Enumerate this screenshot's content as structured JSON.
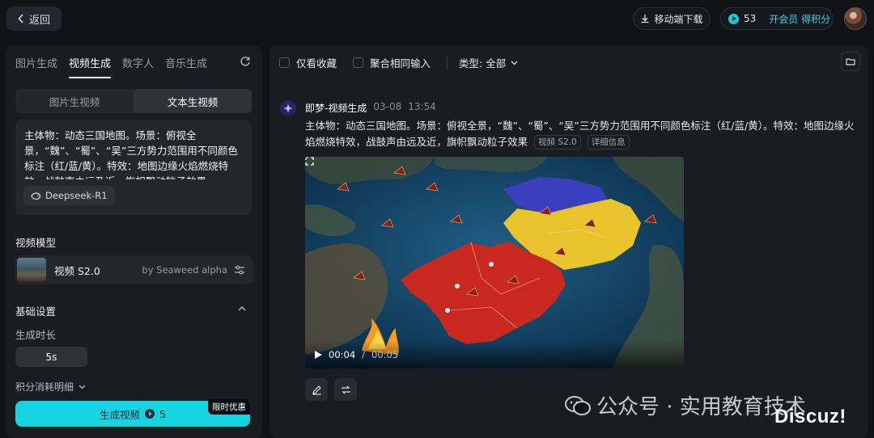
{
  "topbar": {
    "back_label": "返回",
    "download_label": "移动端下载",
    "points": "53",
    "vip_label": "开会员 得积分"
  },
  "left": {
    "tabs": [
      "图片生成",
      "视频生成",
      "数字人",
      "音乐生成"
    ],
    "active_tab": "视频生成",
    "mode_tabs": [
      "图片生视频",
      "文本生视频"
    ],
    "active_mode": "文本生视频",
    "prompt": "主体物：动态三国地图。场景：俯视全景，“魏”、“蜀”、“吴”三方势力范围用不同颜色标注（红/蓝/黄）。特效：地图边缘火焰燃烧特效，战鼓声由远及近，旗帜飘动粒子效果",
    "prompt_model_chip": "Deepseek-R1",
    "model_section": "视频模型",
    "model_name": "视频 S2.0",
    "model_by": "by Seaweed alpha",
    "basic_settings": "基础设置",
    "duration_label": "生成时长",
    "duration_value": "5s",
    "cost_detail": "积分消耗明细",
    "generate_label": "生成视频",
    "generate_cost": "5",
    "promo_badge": "限时优惠"
  },
  "right": {
    "filter_fav": "仅看收藏",
    "filter_merge": "聚合相同输入",
    "filter_type": "类型: 全部",
    "msg_title": "即梦-视频生成",
    "msg_date": "03-08",
    "msg_time": "13:54",
    "msg_prompt": "主体物：动态三国地图。场景：俯视全景，“魏”、“蜀”、“吴”三方势力范围用不同颜色标注（红/蓝/黄）。特效：地图边缘火焰燃烧特效，战鼓声由远及近，旗帜飘动粒子效果",
    "msg_tag_model": "视频 S2.0",
    "msg_tag_detail": "详细信息",
    "video_current": "00:04",
    "video_total": "00:05",
    "video_progress": 0.8
  },
  "watermark": {
    "wechat": "公众号 · 实用教育技术",
    "discuz": "Discuz!"
  },
  "colors": {
    "accent": "#16d3e2",
    "region_red": "#c8281f",
    "region_yellow": "#e8c32b",
    "region_blue": "#3a3fbf"
  }
}
